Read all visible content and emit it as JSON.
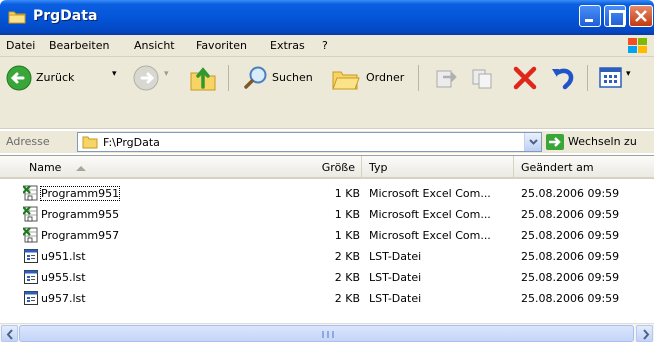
{
  "window": {
    "title": "PrgData"
  },
  "menu": [
    "Datei",
    "Bearbeiten",
    "Ansicht",
    "Favoriten",
    "Extras",
    "?"
  ],
  "toolbar": {
    "back_label": "Zurück",
    "search_label": "Suchen",
    "folders_label": "Ordner"
  },
  "address": {
    "label": "Adresse",
    "path": "F:\\PrgData",
    "go_label": "Wechseln zu"
  },
  "columns": {
    "name": "Name",
    "size": "Größe",
    "type": "Typ",
    "modified": "Geändert am"
  },
  "files": [
    {
      "name": "Programm951",
      "size": "1 KB",
      "type": "Microsoft Excel Com...",
      "modified": "25.08.2006 09:59",
      "icon": "excel-file-icon"
    },
    {
      "name": "Programm955",
      "size": "1 KB",
      "type": "Microsoft Excel Com...",
      "modified": "25.08.2006 09:59",
      "icon": "excel-file-icon"
    },
    {
      "name": "Programm957",
      "size": "1 KB",
      "type": "Microsoft Excel Com...",
      "modified": "25.08.2006 09:59",
      "icon": "excel-file-icon"
    },
    {
      "name": "u951.lst",
      "size": "2 KB",
      "type": "LST-Datei",
      "modified": "25.08.2006 09:59",
      "icon": "lst-file-icon"
    },
    {
      "name": "u955.lst",
      "size": "2 KB",
      "type": "LST-Datei",
      "modified": "25.08.2006 09:59",
      "icon": "lst-file-icon"
    },
    {
      "name": "u957.lst",
      "size": "2 KB",
      "type": "LST-Datei",
      "modified": "25.08.2006 09:59",
      "icon": "lst-file-icon"
    }
  ],
  "colors": {
    "titlebar": "#0555d8",
    "chrome": "#ece9d8",
    "close_button": "#c23a10"
  }
}
